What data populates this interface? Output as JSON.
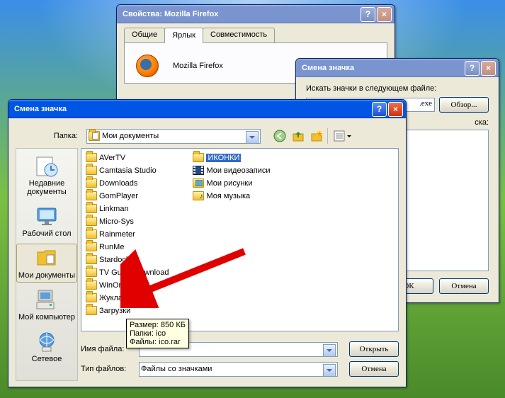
{
  "props_win": {
    "title": "Свойства: Mozilla Firefox",
    "tabs": {
      "general": "Общие",
      "shortcut": "Ярлык",
      "compat": "Совместимость"
    },
    "app_name": "Mozilla Firefox"
  },
  "bg_change_icon": {
    "title": "Смена значка",
    "search_label": "Искать значки в следующем файле:",
    "path_visible": ".exe",
    "browse": "Обзор...",
    "list_label": "ска:",
    "ok": "ОК",
    "cancel": "Отмена"
  },
  "open_dlg": {
    "title": "Смена значка",
    "folder_label": "Папка:",
    "folder_current": "Мои документы",
    "places": {
      "recent": "Недавние документы",
      "desktop": "Рабочий стол",
      "mydocs": "Мои документы",
      "mycomp": "Мой компьютер",
      "network": "Сетевое"
    },
    "files": [
      {
        "type": "folder",
        "name": "AVerTV"
      },
      {
        "type": "folder",
        "name": "Camtasia Studio"
      },
      {
        "type": "folder",
        "name": "Downloads"
      },
      {
        "type": "folder",
        "name": "GomPlayer"
      },
      {
        "type": "folder",
        "name": "Linkman"
      },
      {
        "type": "folder",
        "name": "Micro-Sys"
      },
      {
        "type": "folder",
        "name": "Rainmeter"
      },
      {
        "type": "folder",
        "name": "RunMe"
      },
      {
        "type": "folder",
        "name": "Stardock"
      },
      {
        "type": "folder",
        "name": "TV Guide Download"
      },
      {
        "type": "folder",
        "name": "WinOrganizer"
      },
      {
        "type": "folder",
        "name": "Жукладочник"
      },
      {
        "type": "folder",
        "name": "Загрузки"
      },
      {
        "type": "folder",
        "name": "ИКОНКИ",
        "selected": true
      },
      {
        "type": "video",
        "name": "Мои видеозаписи"
      },
      {
        "type": "pic",
        "name": "Мои рисунки"
      },
      {
        "type": "music",
        "name": "Моя музыка"
      }
    ],
    "filename_label": "Имя файла:",
    "filetype_label": "Тип файлов:",
    "filetype_value": "Файлы со значками",
    "open_btn": "Открыть",
    "cancel_btn": "Отмена",
    "tooltip": {
      "size": "Размер: 850 КБ",
      "folders": "Папки: ico",
      "files": "Файлы: ico.rar"
    }
  }
}
